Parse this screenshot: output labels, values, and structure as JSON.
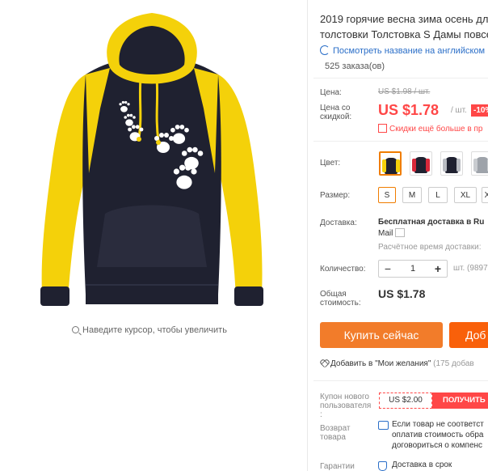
{
  "product": {
    "title_line1": "2019 горячие весна зима осень для",
    "title_line2": "толстовки Толстовка S Дамы повсе",
    "translate_link": "Посмотреть название на английском",
    "orders": "525 заказа(ов)",
    "zoom_hint": "Наведите курсор, чтобы увеличить"
  },
  "pricing": {
    "price_label": "Цена:",
    "old_price": "US $1.98 / шт.",
    "discount_price_label_1": "Цена со",
    "discount_price_label_2": "скидкой:",
    "price": "US $1.78",
    "per_unit": "/ шт.",
    "discount_badge": "-10%",
    "promo_text": "Скидки ещё больше в пр"
  },
  "options": {
    "color_label": "Цвет:",
    "size_label": "Размер:",
    "sizes": [
      "S",
      "M",
      "L",
      "XL",
      "X"
    ],
    "colors": [
      {
        "name": "yellow",
        "body": "#1f2130",
        "accent": "#f4d10a",
        "selected": true
      },
      {
        "name": "red",
        "body": "#1f2130",
        "accent": "#d8283a",
        "selected": false
      },
      {
        "name": "gray",
        "body": "#1f2130",
        "accent": "#b9bcc2",
        "selected": false
      },
      {
        "name": "lightgray",
        "body": "#9ea3aa",
        "accent": "#c9ccd0",
        "selected": false
      }
    ]
  },
  "shipping": {
    "label": "Доставка:",
    "main": "Бесплатная доставка в Ru",
    "method": "Mail",
    "estimate": "Расчётное время доставки:"
  },
  "quantity": {
    "label": "Количество:",
    "minus": "−",
    "value": "1",
    "plus": "+",
    "stock": "шт. (9897"
  },
  "total": {
    "label_1": "Общая",
    "label_2": "стоимость:",
    "value": "US $1.78"
  },
  "actions": {
    "buy_now": "Купить сейчас",
    "add_to_cart": "Доб",
    "wishlist": "Добавить в \"Мои желания\"",
    "wishlist_count": "(175 добав"
  },
  "coupon": {
    "label_1": "Купон нового",
    "label_2": "пользователя",
    "label_3": ":",
    "value": "US $2.00",
    "get": "ПОЛУЧИТЬ"
  },
  "returns": {
    "label_1": "Возврат",
    "label_2": "товара",
    "line1": "Если товар не соответст",
    "line2": "оплатив стоимость обра",
    "line3": "договориться о компенс"
  },
  "guarantee": {
    "label": "Гарантии",
    "text": "Доставка в срок"
  },
  "colors": {
    "accent_red": "#ff4747",
    "buy_orange": "#f27c2a",
    "cart_orange": "#f9600a",
    "link_blue": "#2a6ec8"
  }
}
